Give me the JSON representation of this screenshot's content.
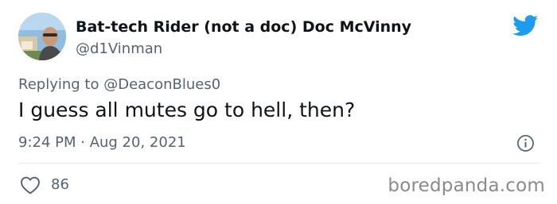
{
  "author": {
    "display_name": "Bat-tech Rider (not a doc) Doc McVinny",
    "handle": "@d1Vinman"
  },
  "reply": {
    "prefix": "Replying to ",
    "mention": "@DeaconBlues0"
  },
  "tweet": {
    "text": "I guess all mutes go to hell, then?",
    "timestamp": "9:24 PM · Aug 20, 2021"
  },
  "engagement": {
    "like_count": "86"
  },
  "watermark": {
    "text": "boredpanda.com"
  },
  "colors": {
    "twitter_blue": "#1d9bf0",
    "secondary_text": "#536471",
    "primary_text": "#0f1419"
  },
  "icons": {
    "brand": "twitter-bird-icon",
    "info": "info-icon",
    "like": "heart-icon"
  }
}
